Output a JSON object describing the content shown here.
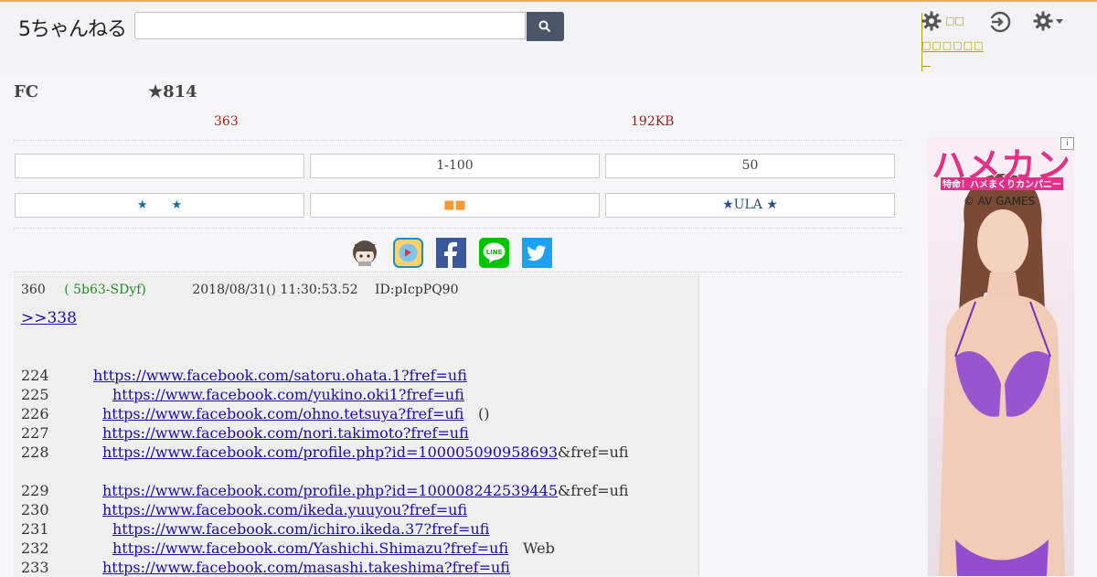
{
  "header": {
    "logo_text": "5ちゃんねる",
    "search": {
      "placeholder": ""
    },
    "tool_label_top": "□□",
    "tool_label_bottom": "□□□□□□"
  },
  "thread": {
    "board": "FC",
    "title": "★814",
    "res_count": "363",
    "size": "192KB"
  },
  "nav_buttons": {
    "row1": [
      "",
      "1-100",
      "50"
    ],
    "row2_left_stars": "★　　★",
    "row2_mid_squares": "■■",
    "row2_right": "★ULA ★"
  },
  "share_icons": [
    "chan-avatar-icon",
    "app-icon",
    "facebook-icon",
    "line-icon",
    "twitter-icon"
  ],
  "post": {
    "number": "360",
    "name": "( 5b63-SDyf)",
    "date": "2018/08/31() 11:30:53.52",
    "id": "ID:pIcpPQ90",
    "reply_link": ">>338",
    "lines": [
      {
        "num": "224",
        "url": "https://www.facebook.com/satoru.ohata.1?fref=ufi",
        "tail": ""
      },
      {
        "num": "225",
        "url": "https://www.facebook.com/yukino.oki1?fref=ufi",
        "tail": ""
      },
      {
        "num": "226",
        "url": "https://www.facebook.com/ohno.tetsuya?fref=ufi",
        "tail": "()"
      },
      {
        "num": "227",
        "url": "https://www.facebook.com/nori.takimoto?fref=ufi",
        "tail": ""
      },
      {
        "num": "228",
        "url": "https://www.facebook.com/profile.php?id=100005090958693",
        "tail": "&fref=ufi"
      },
      {
        "num": "",
        "url": "",
        "tail": ""
      },
      {
        "num": "229",
        "url": "https://www.facebook.com/profile.php?id=100008242539445",
        "tail": "&fref=ufi"
      },
      {
        "num": "230",
        "url": "https://www.facebook.com/ikeda.yuuyou?fref=ufi",
        "tail": ""
      },
      {
        "num": "231",
        "url": "https://www.facebook.com/ichiro.ikeda.37?fref=ufi",
        "tail": ""
      },
      {
        "num": "232",
        "url": "https://www.facebook.com/Yashichi.Shimazu?fref=ufi",
        "tail": "Web"
      },
      {
        "num": "233",
        "url": "https://www.facebook.com/masashi.takeshima?fref=ufi",
        "tail": ""
      }
    ]
  },
  "ad": {
    "title": "ハメカン",
    "subtitle": "特命！ハメまくりカンパニー",
    "brand": "© AV GAMES",
    "badge": "i"
  },
  "colors": {
    "accent_orange": "#f29b30",
    "link": "#1a0dab",
    "stat_red": "#a02020",
    "name_green": "#228b22",
    "facebook": "#3b5998",
    "line": "#00c300",
    "twitter": "#1da1f2"
  }
}
